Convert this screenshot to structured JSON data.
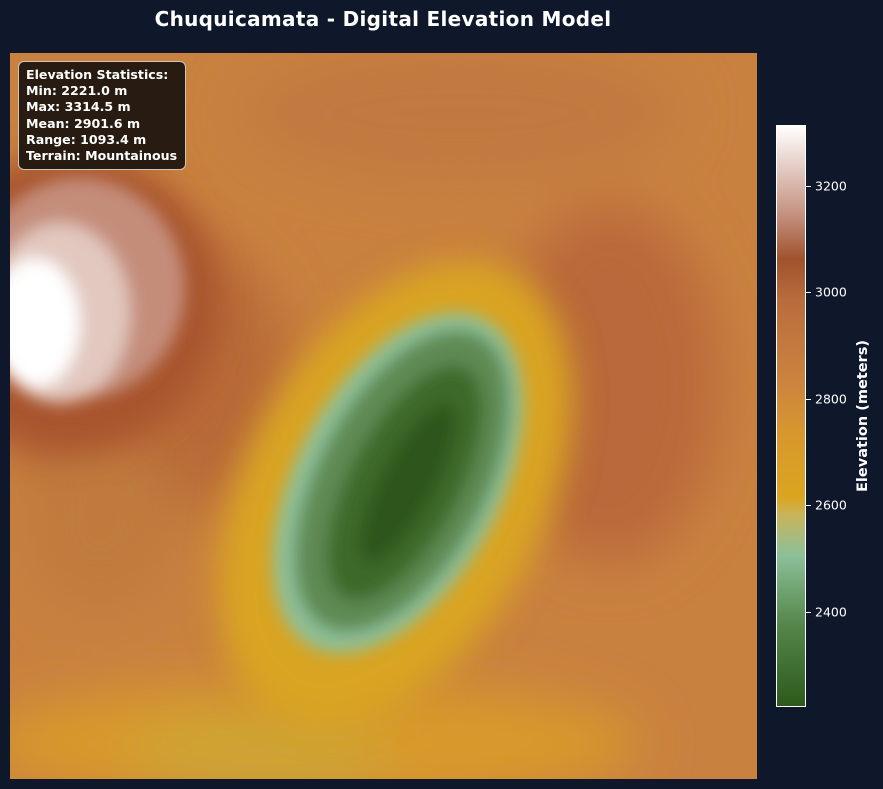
{
  "title": "Chuquicamata - Digital Elevation Model",
  "stats": {
    "heading": "Elevation Statistics:",
    "min": "Min: 2221.0 m",
    "max": "Max: 3314.5 m",
    "mean": "Mean: 2901.6 m",
    "range": "Range: 1093.4 m",
    "terrain": "Terrain: Mountainous"
  },
  "colorbar": {
    "label": "Elevation (meters)",
    "min": 2221.0,
    "max": 3314.5,
    "ticks": [
      "2400",
      "2600",
      "2800",
      "3000",
      "3200"
    ],
    "colors": [
      "#2d5a1b",
      "#8cc099",
      "#daa520",
      "#cd853f",
      "#a0522d",
      "#ffffff"
    ]
  }
}
